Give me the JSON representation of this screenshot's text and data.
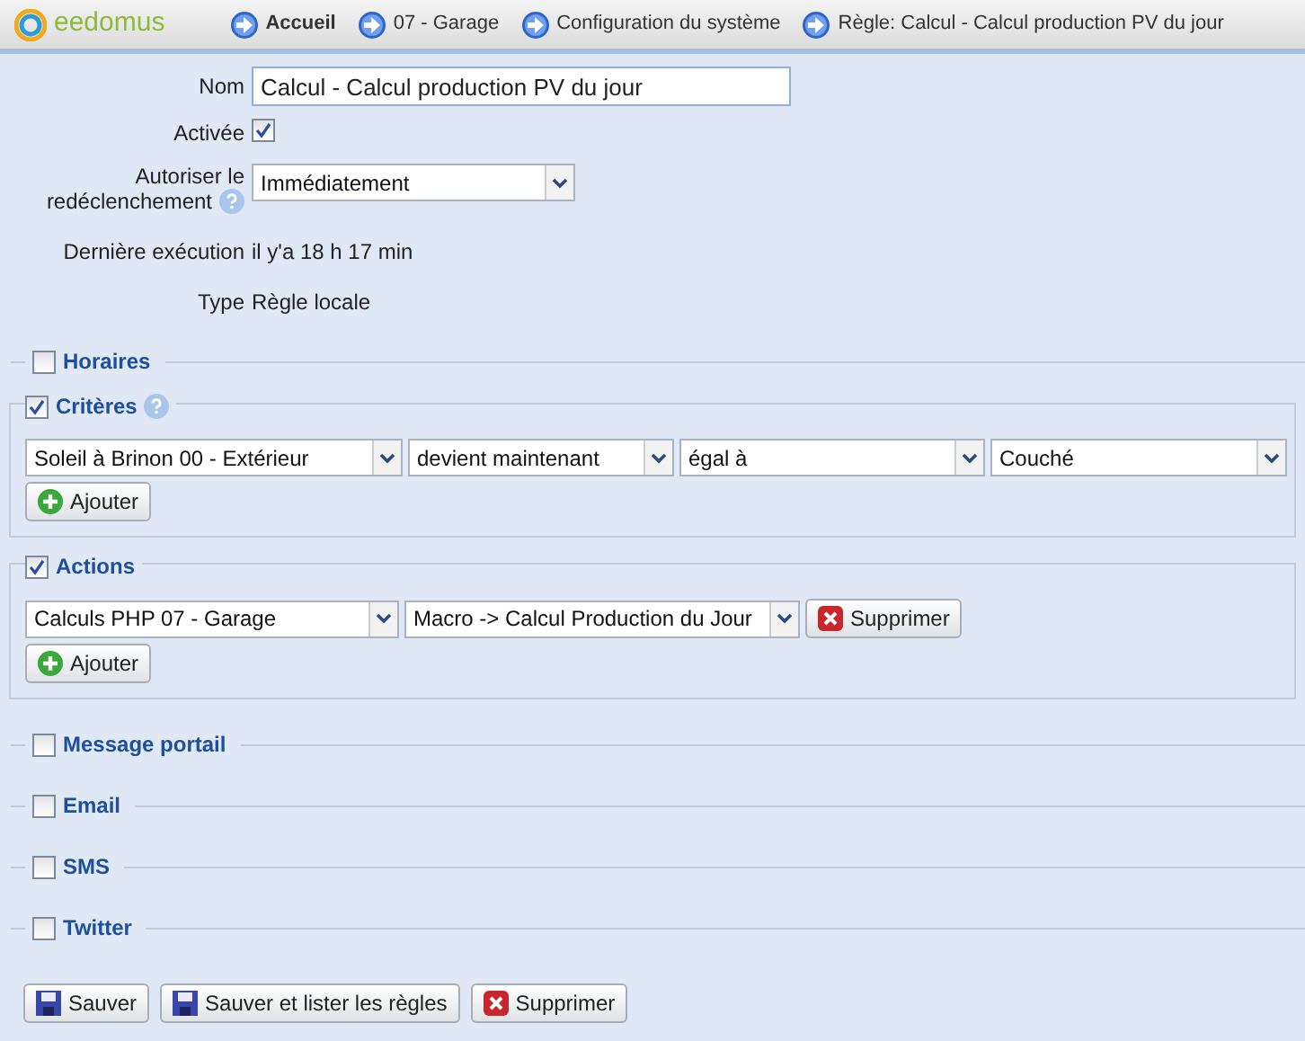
{
  "header": {
    "logo": "eedomus",
    "breadcrumbs": [
      {
        "label": "Accueil",
        "bold": true
      },
      {
        "label": "07 - Garage",
        "bold": false
      },
      {
        "label": "Configuration du système",
        "bold": false
      },
      {
        "label": "Règle: Calcul - Calcul production PV du jour",
        "bold": false
      }
    ]
  },
  "form": {
    "name": {
      "label": "Nom",
      "value": "Calcul - Calcul production PV du jour"
    },
    "enabled": {
      "label": "Activée",
      "checked": true
    },
    "retrigger": {
      "label_1": "Autoriser le",
      "label_2": "redéclenchement",
      "value": "Immédiatement"
    },
    "last_run": {
      "label": "Dernière exécution",
      "value": "il y'a 18 h 17 min"
    },
    "type": {
      "label": "Type",
      "value": "Règle locale"
    }
  },
  "sections": [
    {
      "title": "Horaires",
      "checked": false
    },
    {
      "title": "Critères",
      "checked": true,
      "help": true,
      "rows": [
        {
          "selects": [
            "Soleil à Brinon 00 - Extérieur",
            "devient maintenant",
            "égal à",
            "Couché"
          ]
        }
      ],
      "add_label": "Ajouter"
    },
    {
      "title": "Actions",
      "checked": true,
      "rows": [
        {
          "selects": [
            "Calculs PHP 07 - Garage",
            "Macro -> Calcul Production du Jour"
          ],
          "delete_label": "Supprimer"
        }
      ],
      "add_label": "Ajouter"
    },
    {
      "title": "Message portail",
      "checked": false
    },
    {
      "title": "Email",
      "checked": false
    },
    {
      "title": "SMS",
      "checked": false
    },
    {
      "title": "Twitter",
      "checked": false
    }
  ],
  "buttons": [
    {
      "kind": "save",
      "label": "Sauver"
    },
    {
      "kind": "save",
      "label": "Sauver et lister les règles"
    },
    {
      "kind": "delete",
      "label": "Supprimer"
    }
  ]
}
